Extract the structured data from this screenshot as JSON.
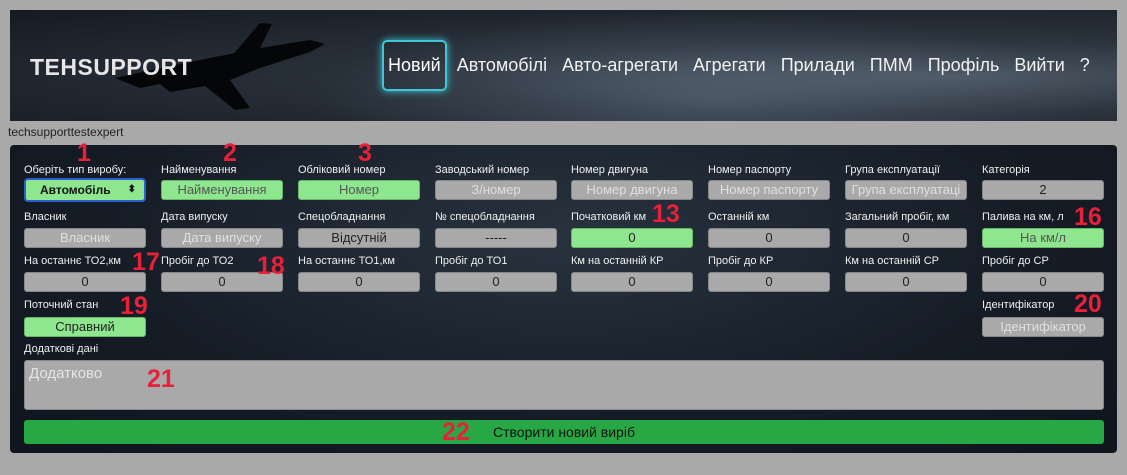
{
  "header": {
    "brand": "TEHSUPPORT",
    "nav": [
      "Новий",
      "Автомобілі",
      "Авто-агрегати",
      "Агрегати",
      "Прилади",
      "ПММ",
      "Профіль",
      "Вийти",
      "?"
    ]
  },
  "user": {
    "name": "techsupporttestexpert"
  },
  "form": {
    "type_label": "Оберіть тип виробу:",
    "type_value": "Автомобіль",
    "name_label": "Найменування",
    "name_placeholder": "Найменування",
    "reg_label": "Обліковий номер",
    "reg_placeholder": "Номер",
    "factory_label": "Заводський номер",
    "factory_placeholder": "З/номер",
    "engine_label": "Номер двигуна",
    "engine_placeholder": "Номер двигуна",
    "passport_label": "Номер паспорту",
    "passport_placeholder": "Номер паспорту",
    "group_label": "Група експлуатації",
    "group_placeholder": "Група експлуатаці",
    "category_label": "Категорія",
    "category_value": "2",
    "owner_label": "Власник",
    "owner_placeholder": "Власник",
    "date_label": "Дата випуску",
    "date_placeholder": "Дата випуску",
    "spec_label": "Спецобладнання",
    "spec_value": "Відсутній",
    "specno_label": "№ спецобладнання",
    "specno_value": "-----",
    "startkm_label": "Початковий км",
    "startkm_value": "0",
    "lastkm_label": "Останній км",
    "lastkm_value": "0",
    "totalkm_label": "Загальний пробіг, км",
    "totalkm_value": "0",
    "fuel_label": "Палива на км, л",
    "fuel_placeholder": "На км/л",
    "to2last_label": "На останнє ТО2,км",
    "to2last_value": "0",
    "to2run_label": "Пробіг до ТО2",
    "to2run_value": "0",
    "to1last_label": "На останнє ТО1,км",
    "to1last_value": "0",
    "to1run_label": "Пробіг до ТО1",
    "to1run_value": "0",
    "krlast_label": "Км на останній КР",
    "krlast_value": "0",
    "krrun_label": "Пробіг до КР",
    "krrun_value": "0",
    "srlast_label": "Км на останній СР",
    "srlast_value": "0",
    "srrun_label": "Пробіг до СР",
    "srrun_value": "0",
    "state_label": "Поточний стан",
    "state_value": "Справний",
    "ident_label": "Ідентифікатор",
    "ident_placeholder": "Ідентифікатор",
    "extra_label": "Додаткові дані",
    "extra_placeholder": "Додатково",
    "submit_label": "Створити новий виріб"
  },
  "annotations": [
    "1",
    "2",
    "3",
    "13",
    "16",
    "17",
    "18",
    "19",
    "20",
    "21",
    "22"
  ],
  "colors": {
    "accent_green": "#8ee68e",
    "submit_green": "#28a745",
    "annotation_red": "#e8203a",
    "active_nav_glow": "#3ec6d6"
  }
}
